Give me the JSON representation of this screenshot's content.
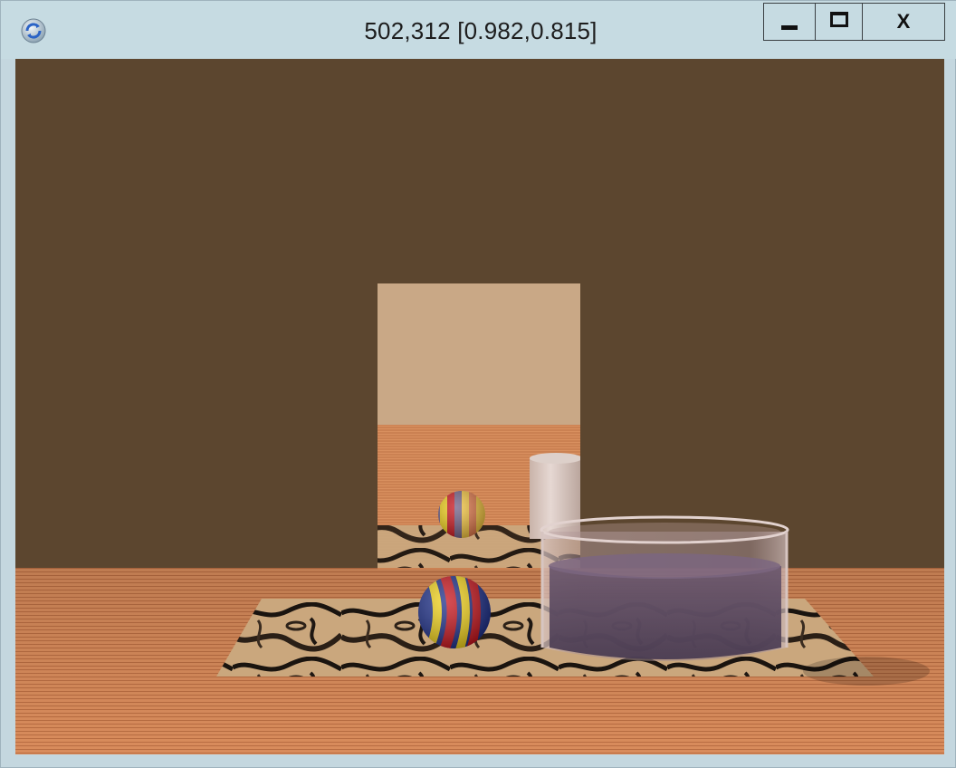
{
  "window": {
    "title": "502,312 [0.982,0.815]",
    "close_label": "X"
  },
  "icons": {
    "app": "refresh-icon",
    "minimize": "minimize-icon",
    "maximize": "maximize-icon",
    "close": "close-icon"
  },
  "scene": {
    "wall_color": "#5c462f",
    "floor_color": "#d4875a",
    "ball_colors": [
      "#f2d21a",
      "#1d2f8a",
      "#c8141c"
    ]
  }
}
